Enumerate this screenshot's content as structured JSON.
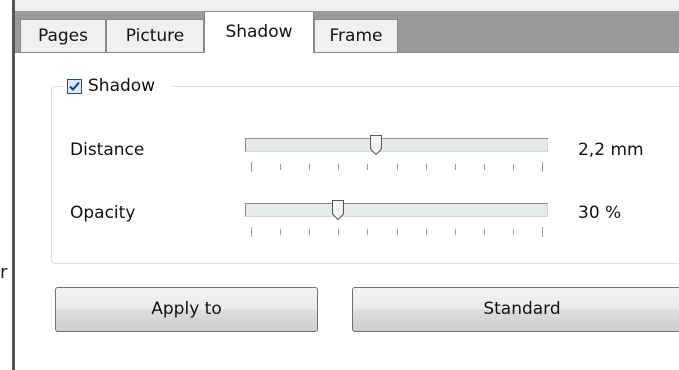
{
  "left_fragments": {
    "quote": "“",
    "letter": "r"
  },
  "tabs": [
    {
      "label": "Pages",
      "active": false
    },
    {
      "label": "Picture",
      "active": false
    },
    {
      "label": "Shadow",
      "active": true
    },
    {
      "label": "Frame",
      "active": false
    }
  ],
  "shadow_group": {
    "checkbox_label": "Shadow",
    "checked": true,
    "distance": {
      "label": "Distance",
      "value_text": "2,2 mm",
      "slider_fraction": 0.43
    },
    "opacity": {
      "label": "Opacity",
      "value_text": "30 %",
      "slider_fraction": 0.3
    }
  },
  "buttons": {
    "apply_to": "Apply to",
    "standard": "Standard"
  },
  "colors": {
    "tabbar_bg": "#9a9a9a",
    "panel_bg": "#ffffff",
    "checkbox_check": "#1c3f8e"
  }
}
